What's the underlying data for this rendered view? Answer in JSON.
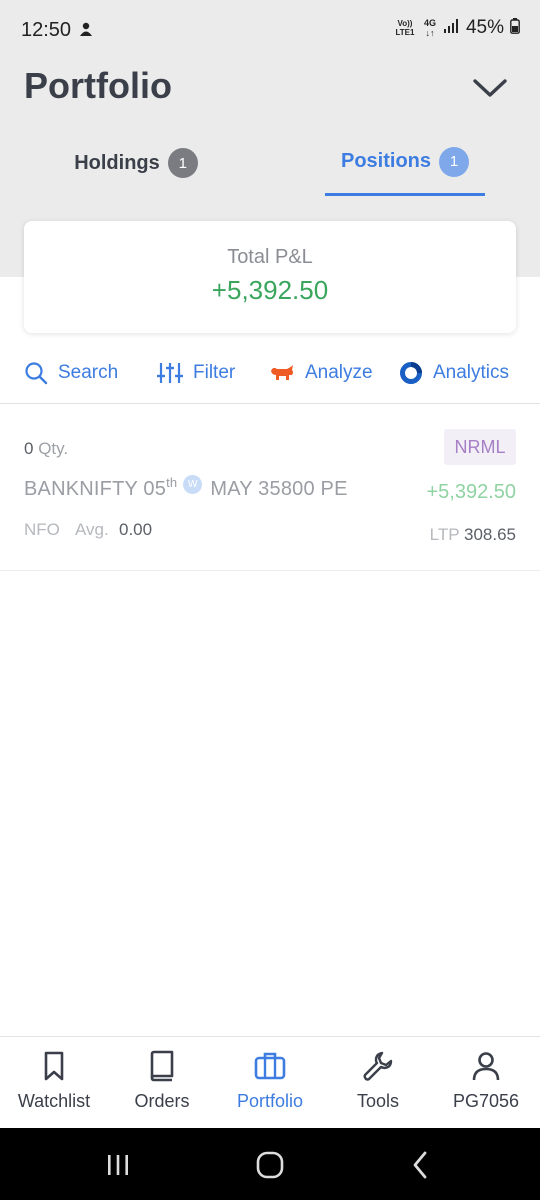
{
  "status_bar": {
    "time": "12:50",
    "volte": [
      "Vo))",
      "LTE1"
    ],
    "network": "4G",
    "battery": "45%"
  },
  "header": {
    "title": "Portfolio"
  },
  "tabs": [
    {
      "label": "Holdings",
      "count": "1",
      "active": false
    },
    {
      "label": "Positions",
      "count": "1",
      "active": true
    }
  ],
  "summary": {
    "label": "Total P&L",
    "value": "+5,392.50"
  },
  "toolbar": {
    "search": "Search",
    "filter": "Filter",
    "analyze": "Analyze",
    "analytics": "Analytics"
  },
  "positions": [
    {
      "qty": "0",
      "qty_label": "Qty.",
      "product": "NRML",
      "symbol_part1": "BANKNIFTY 05",
      "symbol_sup": "th",
      "weekly_tag": "W",
      "symbol_part2": "MAY 35800 PE",
      "pnl": "+5,392.50",
      "exchange": "NFO",
      "avg_label": "Avg.",
      "avg_value": "0.00",
      "ltp_label": "LTP",
      "ltp_value": "308.65"
    }
  ],
  "bottom_nav": [
    {
      "label": "Watchlist",
      "icon": "bookmark-icon"
    },
    {
      "label": "Orders",
      "icon": "book-icon"
    },
    {
      "label": "Portfolio",
      "icon": "briefcase-icon",
      "active": true
    },
    {
      "label": "Tools",
      "icon": "wrench-icon"
    },
    {
      "label": "PG7056",
      "icon": "user-icon"
    }
  ],
  "colors": {
    "accent": "#3d7ce0",
    "profit": "#3aa55c",
    "product_badge": "#a77fc6"
  }
}
